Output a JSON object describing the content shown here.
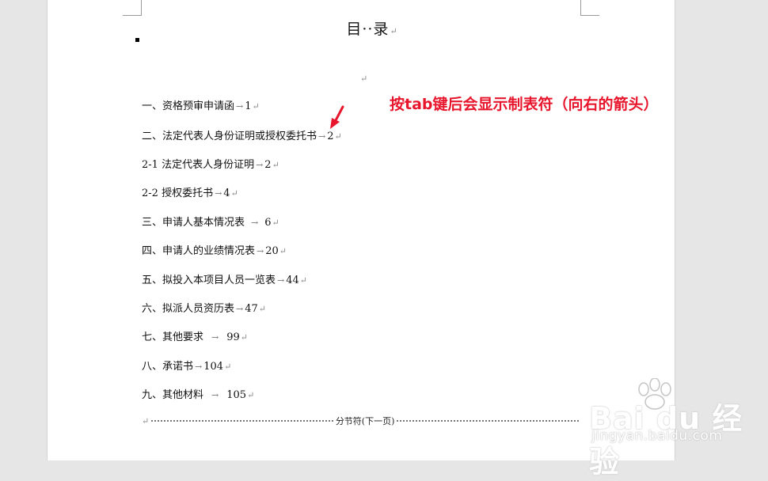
{
  "document": {
    "title": "目··录",
    "paragraph_mark": "↵",
    "tab_mark": "→",
    "toc": [
      {
        "label": "一、资格预审申请函",
        "page": "1"
      },
      {
        "label": "二、法定代表人身份证明或授权委托书",
        "page": "2"
      },
      {
        "label": "2-1 法定代表人身份证明",
        "page": "2"
      },
      {
        "label": "2-2 授权委托书",
        "page": "4"
      },
      {
        "label": "三、申请人基本情况表",
        "page": "6"
      },
      {
        "label": "四、申请人的业绩情况表",
        "page": "20"
      },
      {
        "label": "五、拟投入本项目人员一览表",
        "page": "44"
      },
      {
        "label": "六、拟派人员资历表",
        "page": "47"
      },
      {
        "label": "七、其他要求",
        "page": "99"
      },
      {
        "label": "八、承诺书",
        "page": "104"
      },
      {
        "label": "九、其他材料",
        "page": "105"
      }
    ],
    "section_break_label": "分节符(下一页)"
  },
  "annotation": {
    "text": "按tab键后会显示制表符（向右的箭头）",
    "color": "#e8162c"
  },
  "watermark": {
    "brand": "Bai du 经验",
    "url": "jingyan.baidu.com"
  },
  "colors": {
    "workspace_bg": "#e6e6e6",
    "page_bg": "#ffffff",
    "annotation_red": "#e8162c"
  }
}
